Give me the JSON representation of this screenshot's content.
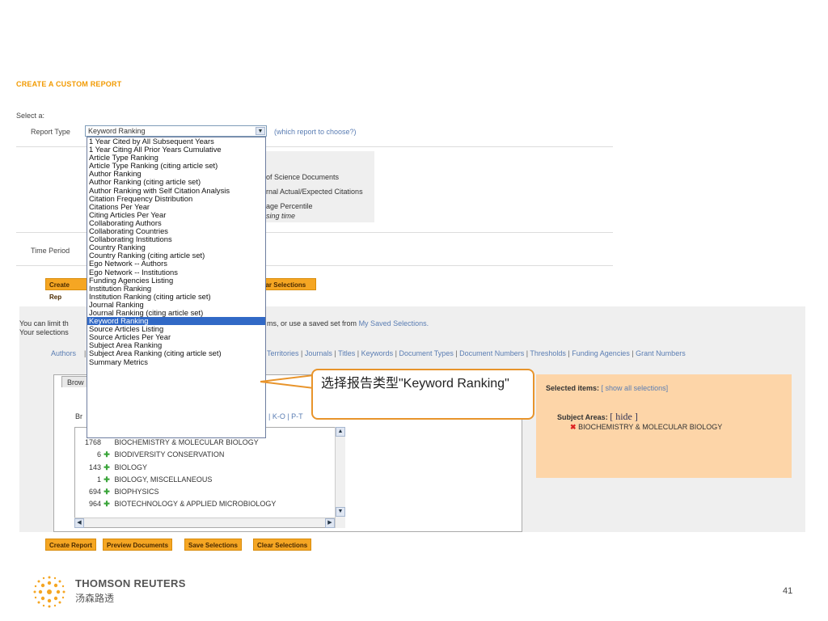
{
  "page_title": "CREATE A CUSTOM REPORT",
  "select_a": "Select a:",
  "report_type": {
    "label": "Report Type",
    "selected": "Keyword Ranking",
    "help_link": "(which report to choose?)",
    "options": [
      "1 Year Cited by All Subsequent Years",
      "1 Year Citing All Prior Years Cumulative",
      "Article Type Ranking",
      "Article Type Ranking (citing article set)",
      "Author Ranking",
      "Author Ranking (citing article set)",
      "Author Ranking with Self Citation Analysis",
      "Citation Frequency Distribution",
      "Citations Per Year",
      "Citing Articles Per Year",
      "Collaborating Authors",
      "Collaborating Countries",
      "Collaborating Institutions",
      "Country Ranking",
      "Country Ranking (citing article set)",
      "Ego Network -- Authors",
      "Ego Network -- Institutions",
      "Funding Agencies Listing",
      "Institution Ranking",
      "Institution Ranking (citing article set)",
      "Journal Ranking",
      "Journal Ranking (citing article set)",
      "Keyword Ranking",
      "Source Articles Listing",
      "Source Articles Per Year",
      "Subject Area Ranking",
      "Subject Area Ranking (citing article set)",
      "Summary Metrics"
    ],
    "highlighted_index": 22
  },
  "metrics_partial": [
    "of Science Documents",
    "rnal Actual/Expected Citations",
    "age Percentile",
    "sing time"
  ],
  "time_period_label": "Time Period",
  "buttons": {
    "create_report": "Create Report",
    "create_report_partial": "Create Rep",
    "preview_documents": "Preview Documents",
    "save_selections": "Save Selections",
    "clear_selections": "Clear Selections",
    "clear_selections_partial": "ear Selections"
  },
  "limit_text_1": "You can limit th",
  "limit_text_1_tail": "ms, or use a saved set from",
  "saved_link": "My Saved Selections.",
  "limit_text_2": "Your selections",
  "filters": {
    "authors": "Authors",
    "separator": "|",
    "tail": [
      "Territories",
      "Journals",
      "Titles",
      "Keywords",
      "Document Types",
      "Document Numbers",
      "Thresholds",
      "Funding Agencies",
      "Grant Numbers"
    ]
  },
  "browse_tab": "Brow",
  "browse_label": "Br",
  "alpha_partial": "| K-O | P-T",
  "subject_rows": [
    {
      "count": "1768",
      "name": "BIOCHEMISTRY & MOLECULAR BIOLOGY",
      "plus": false
    },
    {
      "count": "6",
      "name": "BIODIVERSITY CONSERVATION",
      "plus": true
    },
    {
      "count": "143",
      "name": "BIOLOGY",
      "plus": true
    },
    {
      "count": "1",
      "name": "BIOLOGY, MISCELLANEOUS",
      "plus": true
    },
    {
      "count": "694",
      "name": "BIOPHYSICS",
      "plus": true
    },
    {
      "count": "964",
      "name": "BIOTECHNOLOGY & APPLIED MICROBIOLOGY",
      "plus": true
    }
  ],
  "selected_panel": {
    "title": "Selected items:",
    "show_all": "[ show all selections]",
    "subject_areas_label": "Subject Areas:",
    "hide_link": "[ hide ]",
    "item": "BIOCHEMISTRY & MOLECULAR BIOLOGY"
  },
  "callout": "选择报告类型\"Keyword Ranking\"",
  "logo": {
    "name": "THOMSON REUTERS",
    "cn": "汤森路透"
  },
  "page_number": "41",
  "colors": {
    "orange_title": "#f29a00",
    "button": "#f5a623",
    "highlight": "#3169c6",
    "selected_panel": "#fdd5a8",
    "callout_border": "#e8942b"
  }
}
